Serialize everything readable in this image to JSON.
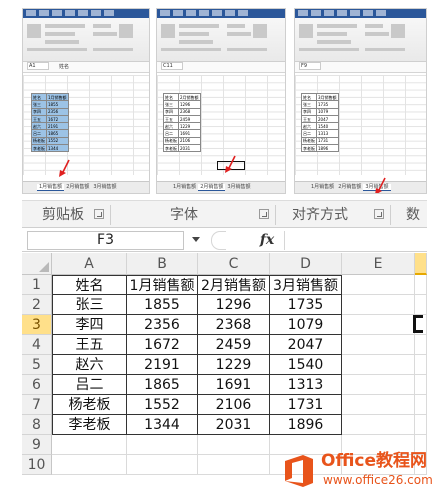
{
  "thumbnails": [
    {
      "namebox": "A1",
      "formula": "姓名",
      "active_tab": "1月销售额",
      "sheet_tabs": [
        "1月销售额",
        "2月销售额",
        "3月销售额"
      ],
      "headers": [
        "姓名",
        "1月销售额"
      ],
      "rows": [
        [
          "张三",
          "1855"
        ],
        [
          "李四",
          "2356"
        ],
        [
          "王五",
          "1672"
        ],
        [
          "赵六",
          "2191"
        ],
        [
          "吕二",
          "1865"
        ],
        [
          "杨老板",
          "1552"
        ],
        [
          "李老板",
          "1344"
        ]
      ]
    },
    {
      "namebox": "C11",
      "formula": "",
      "active_tab": "2月销售额",
      "sheet_tabs": [
        "1月销售额",
        "2月销售额",
        "3月销售额"
      ],
      "headers": [
        "姓名",
        "2月销售额"
      ],
      "rows": [
        [
          "张三",
          "1296"
        ],
        [
          "李四",
          "2368"
        ],
        [
          "王五",
          "2459"
        ],
        [
          "赵六",
          "1229"
        ],
        [
          "吕二",
          "1691"
        ],
        [
          "杨老板",
          "2106"
        ],
        [
          "李老板",
          "2031"
        ]
      ]
    },
    {
      "namebox": "F9",
      "formula": "",
      "active_tab": "3月销售额",
      "sheet_tabs": [
        "1月销售额",
        "2月销售额",
        "3月销售额"
      ],
      "headers": [
        "姓名",
        "3月销售额"
      ],
      "rows": [
        [
          "张三",
          "1735"
        ],
        [
          "李四",
          "1079"
        ],
        [
          "王五",
          "2047"
        ],
        [
          "赵六",
          "1540"
        ],
        [
          "吕二",
          "1313"
        ],
        [
          "杨老板",
          "1731"
        ],
        [
          "李老板",
          "1896"
        ]
      ]
    }
  ],
  "ribbon_groups": [
    "剪贴板",
    "字体",
    "对齐方式",
    "数"
  ],
  "formula_bar": {
    "namebox": "F3",
    "fx": "fx",
    "value": ""
  },
  "sheet": {
    "columns": [
      "A",
      "B",
      "C",
      "D",
      "E"
    ],
    "rows": [
      "1",
      "2",
      "3",
      "4",
      "5",
      "6",
      "7",
      "8",
      "9",
      "10"
    ],
    "active_row": "3",
    "table": [
      [
        "姓名",
        "1月销售额",
        "2月销售额",
        "3月销售额"
      ],
      [
        "张三",
        "1855",
        "1296",
        "1735"
      ],
      [
        "李四",
        "2356",
        "2368",
        "1079"
      ],
      [
        "王五",
        "1672",
        "2459",
        "2047"
      ],
      [
        "赵六",
        "2191",
        "1229",
        "1540"
      ],
      [
        "吕二",
        "1865",
        "1691",
        "1313"
      ],
      [
        "杨老板",
        "1552",
        "2106",
        "1731"
      ],
      [
        "李老板",
        "1344",
        "2031",
        "1896"
      ]
    ]
  },
  "watermark": {
    "title": "Office教程网",
    "url": "www.office26.com"
  },
  "colors": {
    "excel_green": "#217346",
    "highlight": "#ffe08a",
    "watermark_orange": "#e8541b"
  }
}
